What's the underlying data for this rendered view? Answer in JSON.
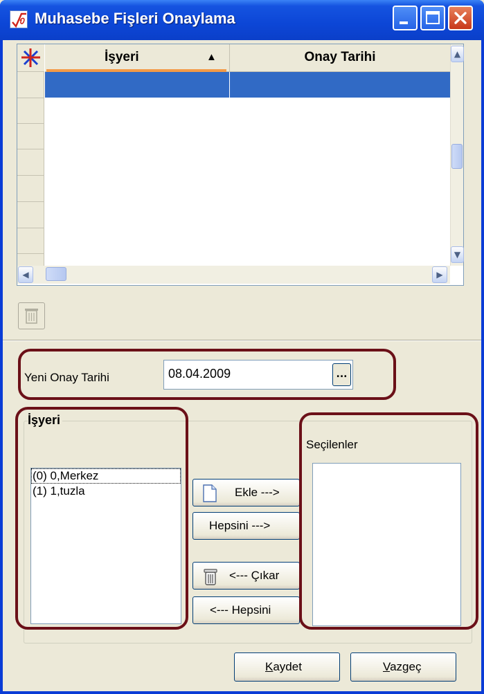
{
  "window": {
    "title": "Muhasebe Fişleri Onaylama",
    "controls": [
      "minimize",
      "maximize",
      "close"
    ]
  },
  "grid": {
    "columns": [
      {
        "label": "İşyeri",
        "sorted": "ascending",
        "sort_glyph": "▲"
      },
      {
        "label": "Onay Tarihi"
      }
    ],
    "rows": [
      {
        "isyeri": "",
        "onay_tarihi": "",
        "selected": true
      }
    ],
    "icons": {
      "corner": "grid-select-icon",
      "delete": "trash-icon"
    }
  },
  "new_date": {
    "label": "Yeni Onay Tarihi",
    "value": "08.04.2009",
    "picker_label": "..."
  },
  "isyeri_group": {
    "title": "İşyeri",
    "items": [
      "(0) 0,Merkez",
      "(1) 1,tuzla"
    ],
    "focused_index": 0
  },
  "transfer_buttons": {
    "add": "Ekle --->",
    "add_all": "Hepsini --->",
    "remove": "<--- Çıkar",
    "remove_all": "<--- Hepsini"
  },
  "selected_group": {
    "title": "Seçilenler",
    "items": []
  },
  "footer": {
    "save": "Kaydet",
    "save_accesskey": "K",
    "cancel": "Vazgeç",
    "cancel_accesskey": "V"
  },
  "colors": {
    "title_bar": "#0c46d6",
    "selection": "#316ac5",
    "sort_indicator": "#f49a46",
    "highlight_box": "#6b1018",
    "face": "#ece9d8"
  }
}
